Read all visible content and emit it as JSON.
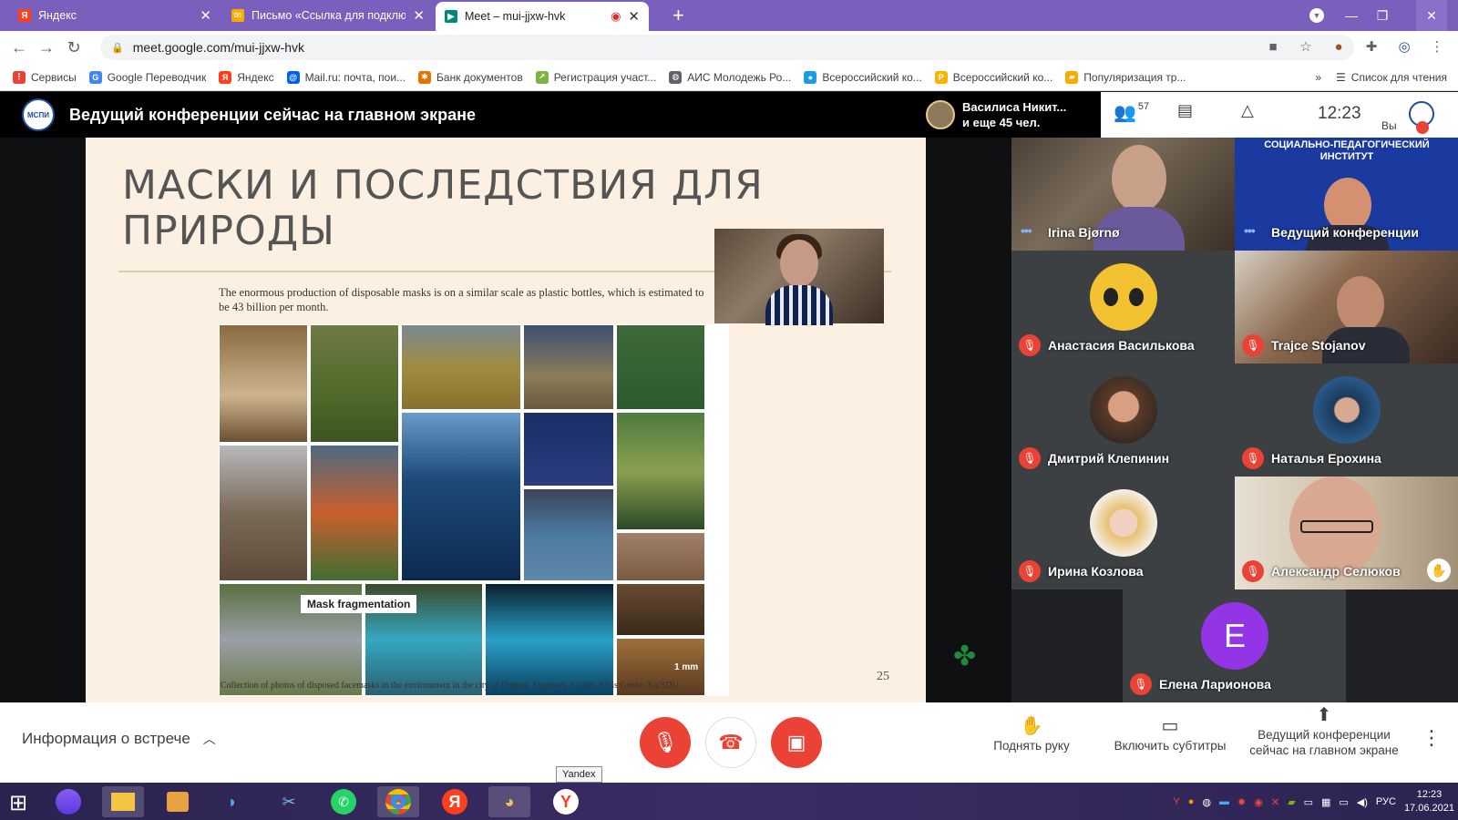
{
  "browser": {
    "tabs": [
      {
        "title": "Яндекс",
        "icon": "yandex-icon",
        "active": false
      },
      {
        "title": "Письмо «Ссылка для подключе",
        "icon": "mail-icon",
        "active": false
      },
      {
        "title": "Meet – mui-jjxw-hvk",
        "icon": "meet-icon",
        "active": true
      }
    ],
    "url": "meet.google.com/mui-jjxw-hvk",
    "bookmarks": [
      "Сервисы",
      "Google Переводчик",
      "Яндекс",
      "Mail.ru: почта, пои...",
      "Банк документов",
      "Регистрация участ...",
      "АИС Молодежь Ро...",
      "Всероссийский ко...",
      "Всероссийский ко...",
      "Популяризация тр..."
    ],
    "reading_list": "Список для чтения",
    "more_bookmarks": "»"
  },
  "meet": {
    "presenting_banner": "Ведущий конференции сейчас на главном экране",
    "logo_text": "МСПИ",
    "speaker_line1": "Василиса Никит...",
    "speaker_line2": "и еще 45 чел.",
    "participants_count": "57",
    "clock": "12:23",
    "self_label": "Вы"
  },
  "slide": {
    "title_line1": "МАСКИ И ПОСЛЕДСТВИЯ ДЛЯ",
    "title_line2": "ПРИРОДЫ",
    "text": "The enormous production of disposable masks is on a similar scale as plastic bottles, which is estimated to be 43 billion per month.",
    "mask_label": "Mask fragmentation",
    "scale_label": "1 mm",
    "caption": "Collection of photos of disposed facemasks in the environment in the city of Odense, Denmark. Credit: Elvis Genbo Xu/SDU",
    "page_number": "25"
  },
  "participants": [
    {
      "name": "Irina Bjørnø",
      "muted": false
    },
    {
      "name": "Ведущий конференции",
      "muted": false
    },
    {
      "name": "Анастасия Василькова",
      "muted": true
    },
    {
      "name": "Trajce Stojanov",
      "muted": true
    },
    {
      "name": "Дмитрий Клепинин",
      "muted": true
    },
    {
      "name": "Наталья Ерохина",
      "muted": true
    },
    {
      "name": "Ирина Козлова",
      "muted": true
    },
    {
      "name": "Александр Селюков",
      "muted": true
    },
    {
      "name": "Елена Ларионова",
      "muted": true,
      "initial": "Е"
    }
  ],
  "institute_banner": "СОЦИАЛЬНО-ПЕДАГОГИЧЕСКИЙ ИНСТИТУТ",
  "controls": {
    "meeting_info": "Информация о встрече",
    "raise_hand": "Поднять руку",
    "captions": "Включить субтитры",
    "presenting": "Ведущий конференции сейчас на главном экране"
  },
  "tooltip": "Yandex",
  "taskbar": {
    "language": "РУС",
    "time": "12:23",
    "date": "17.06.2021"
  },
  "colors": {
    "tab_strip": "#7a5fbd",
    "mute_red": "#ea4335",
    "avatar_purple": "#9334e6"
  }
}
